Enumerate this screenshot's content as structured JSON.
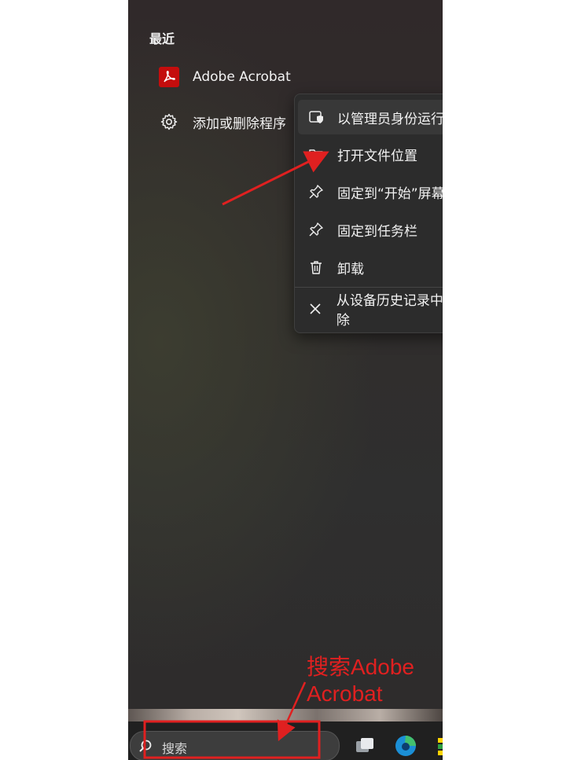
{
  "start_menu": {
    "recent_title": "最近",
    "recent_items": [
      {
        "label": "Adobe Acrobat",
        "icon": "adobe-acrobat-icon"
      },
      {
        "label": "添加或删除程序",
        "icon": "gear-icon"
      }
    ]
  },
  "context_menu": {
    "items": [
      {
        "label": "以管理员身份运行",
        "icon": "shield-icon"
      },
      {
        "label": "打开文件位置",
        "icon": "folder-icon"
      },
      {
        "label": "固定到“开始”屏幕",
        "icon": "pin-icon"
      },
      {
        "label": "固定到任务栏",
        "icon": "pin-icon"
      },
      {
        "label": "卸载",
        "icon": "trash-icon"
      },
      {
        "label": "从设备历史记录中删除",
        "icon": "close-icon"
      }
    ]
  },
  "taskbar": {
    "search_placeholder": "搜索"
  },
  "annotation": {
    "search_hint": [
      "搜索Adobe",
      "Acrobat"
    ],
    "color": "#e02020"
  }
}
